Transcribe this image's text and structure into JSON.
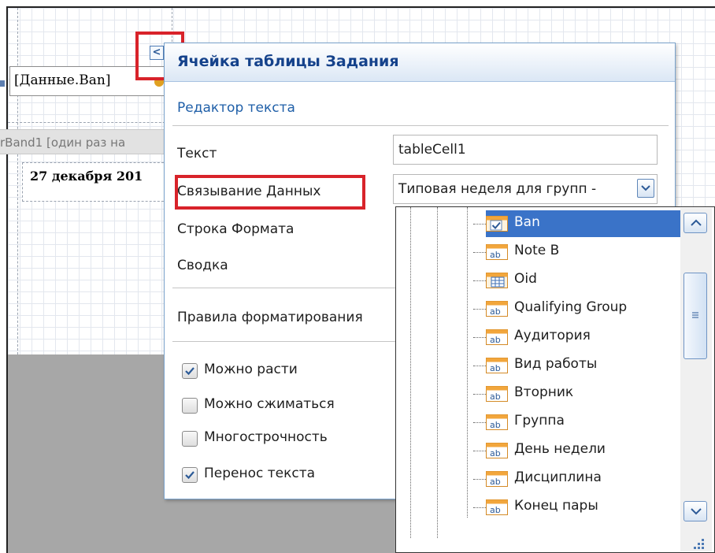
{
  "report": {
    "ban_field": "[Данные.Ban]",
    "band_label": "rBand1 [один раз на",
    "date_text": "27 декабря 201"
  },
  "smart_tag": {
    "glyph": "<",
    "icon": "chevron-left-icon"
  },
  "panel": {
    "title": "Ячейка таблицы Задания",
    "section": "Редактор текста",
    "props": {
      "text_label": "Текст",
      "text_value": "tableCell1",
      "binding_label": "Связывание Данных",
      "binding_value": "Типовая неделя для групп -",
      "format_label": "Строка Формата",
      "summary_label": "Сводка",
      "rules_label": "Правила форматирования"
    },
    "checkboxes": [
      {
        "label": "Можно расти",
        "checked": true
      },
      {
        "label": "Можно сжиматься",
        "checked": false
      },
      {
        "label": "Многострочность",
        "checked": false
      },
      {
        "label": "Перенос текста",
        "checked": true
      }
    ]
  },
  "dropdown": {
    "items": [
      {
        "label": "Ban",
        "icon": "checkbox-field-icon",
        "selected": true
      },
      {
        "label": "Note B",
        "icon": "text-field-icon"
      },
      {
        "label": "Oid",
        "icon": "table-field-icon"
      },
      {
        "label": "Qualifying Group",
        "icon": "text-field-icon"
      },
      {
        "label": "Аудитория",
        "icon": "text-field-icon"
      },
      {
        "label": "Вид работы",
        "icon": "text-field-icon"
      },
      {
        "label": "Вторник",
        "icon": "text-field-icon"
      },
      {
        "label": "Группа",
        "icon": "text-field-icon"
      },
      {
        "label": "День недели",
        "icon": "text-field-icon"
      },
      {
        "label": "Дисциплина",
        "icon": "text-field-icon"
      },
      {
        "label": "Конец пары",
        "icon": "text-field-icon"
      }
    ]
  },
  "colors": {
    "highlight": "#d8232a",
    "selection": "#3a73c8",
    "title": "#15428b"
  }
}
